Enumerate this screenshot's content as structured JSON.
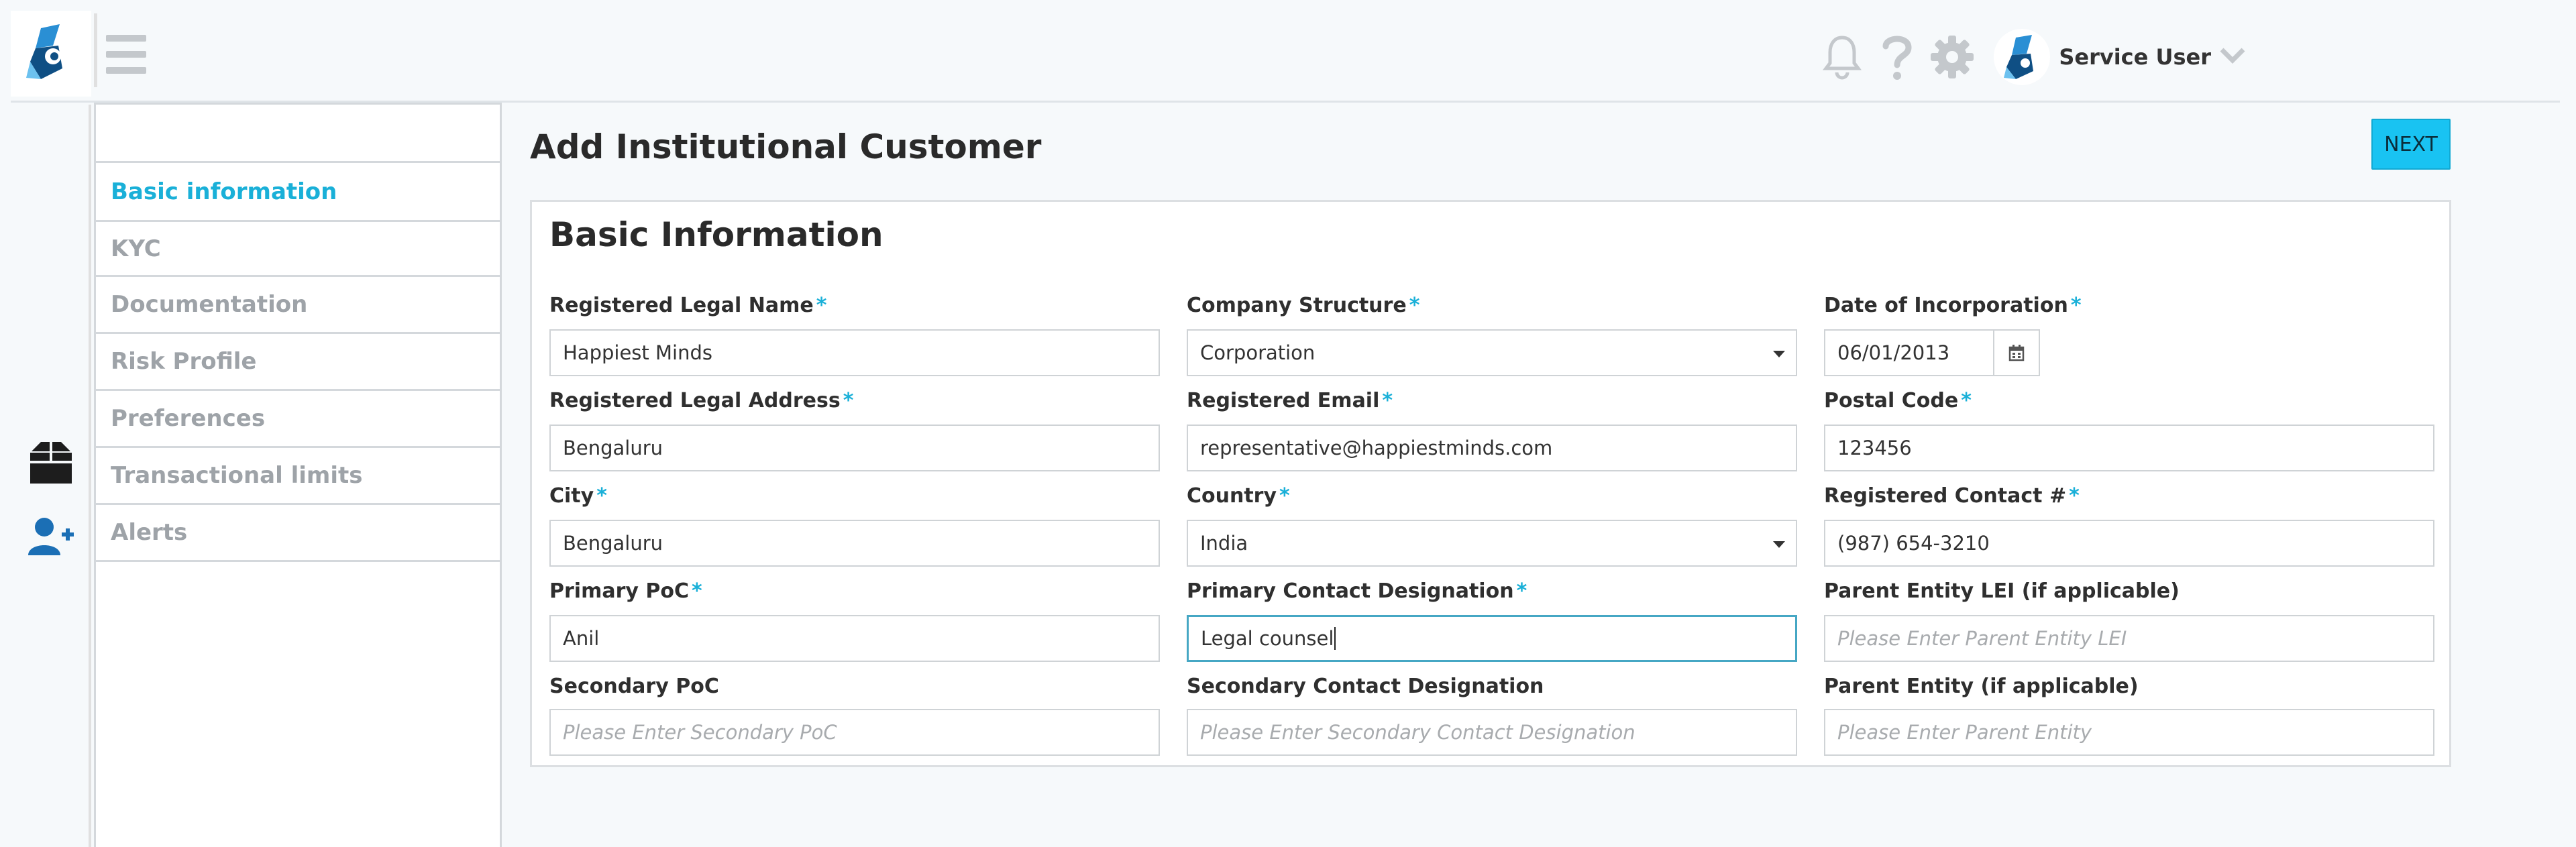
{
  "header": {
    "logo_icon": "app-logo-icon",
    "menu_icon": "hamburger-icon",
    "icons": [
      "bell-icon",
      "help-icon",
      "gear-icon"
    ],
    "user": {
      "name": "Service User",
      "avatar_icon": "user-avatar-icon",
      "caret_icon": "chevron-down-icon"
    }
  },
  "rail": {
    "items": [
      "products-box-icon",
      "add-user-icon"
    ]
  },
  "sidebar": {
    "steps": [
      {
        "label": "Basic information",
        "active": true
      },
      {
        "label": "KYC"
      },
      {
        "label": "Documentation"
      },
      {
        "label": "Risk Profile"
      },
      {
        "label": "Preferences"
      },
      {
        "label": "Transactional limits"
      },
      {
        "label": "Alerts"
      }
    ]
  },
  "page": {
    "title": "Add Institutional Customer",
    "next_label": "NEXT"
  },
  "form": {
    "title": "Basic Information",
    "required_mark": "*",
    "fields": {
      "legal_name": {
        "label": "Registered Legal Name",
        "value": "Happiest Minds"
      },
      "company_structure": {
        "label": "Company Structure",
        "value": "Corporation"
      },
      "incorporation_date": {
        "label": "Date of Incorporation",
        "value": "06/01/2013"
      },
      "legal_address": {
        "label": "Registered Legal Address",
        "value": "Bengaluru"
      },
      "email": {
        "label": "Registered Email",
        "value": "representative@happiestminds.com"
      },
      "postal_code": {
        "label": "Postal Code",
        "value": "123456"
      },
      "city": {
        "label": "City",
        "value": "Bengaluru"
      },
      "country": {
        "label": "Country",
        "value": "India"
      },
      "contact_number": {
        "label": "Registered Contact #",
        "value": "(987) 654-3210"
      },
      "primary_poc": {
        "label": "Primary PoC",
        "value": "Anil"
      },
      "primary_designation": {
        "label": "Primary Contact Designation",
        "value": "Legal counsel"
      },
      "parent_lei": {
        "label": "Parent Entity LEI (if applicable)",
        "placeholder": "Please Enter Parent Entity LEI"
      },
      "secondary_poc": {
        "label": "Secondary PoC",
        "placeholder": "Please Enter Secondary PoC"
      },
      "secondary_designation": {
        "label": "Secondary Contact Designation",
        "placeholder": "Please Enter Secondary Contact Designation"
      },
      "parent_entity": {
        "label": "Parent Entity (if applicable)",
        "placeholder": "Please Enter Parent Entity"
      }
    }
  },
  "colors": {
    "accent": "#1ab0d8",
    "button": "#19c3f2",
    "icon_gray": "#c4c8cc",
    "brand_blue": "#1b6fb5"
  }
}
